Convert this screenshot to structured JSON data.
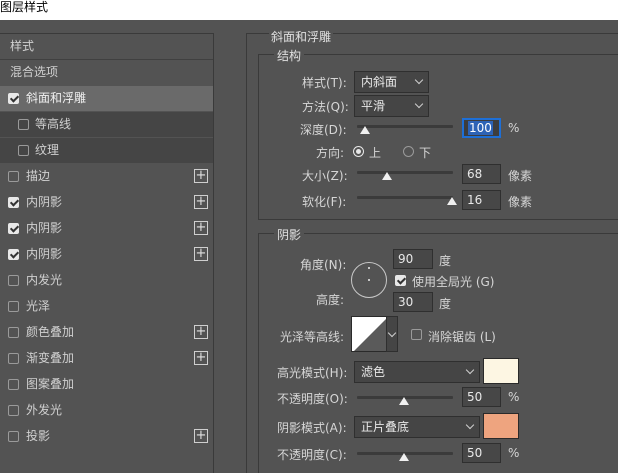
{
  "window": {
    "title": "图层样式"
  },
  "sidebar": {
    "header": "样式",
    "blend_options": "混合选项",
    "items": [
      {
        "label": "斜面和浮雕",
        "checked": true
      },
      {
        "label": "等高线",
        "checked": false
      },
      {
        "label": "纹理",
        "checked": false
      },
      {
        "label": "描边",
        "checked": false
      },
      {
        "label": "内阴影",
        "checked": true
      },
      {
        "label": "内阴影",
        "checked": true
      },
      {
        "label": "内阴影",
        "checked": true
      },
      {
        "label": "内发光",
        "checked": false
      },
      {
        "label": "光泽",
        "checked": false
      },
      {
        "label": "颜色叠加",
        "checked": false
      },
      {
        "label": "渐变叠加",
        "checked": false
      },
      {
        "label": "图案叠加",
        "checked": false
      },
      {
        "label": "外发光",
        "checked": false
      },
      {
        "label": "投影",
        "checked": false
      }
    ],
    "add_icon": "plus-icon"
  },
  "panel": {
    "title": "斜面和浮雕",
    "structure": {
      "legend": "结构",
      "style_label": "样式(T):",
      "style_value": "内斜面",
      "technique_label": "方法(Q):",
      "technique_value": "平滑",
      "depth_label": "深度(D):",
      "depth_value": "100",
      "depth_unit": "%",
      "depth_slider": 0.08,
      "direction_label": "方向:",
      "direction_up": "上",
      "direction_down": "下",
      "size_label": "大小(Z):",
      "size_value": "68",
      "size_unit": "像素",
      "size_slider": 0.3,
      "soften_label": "软化(F):",
      "soften_value": "16",
      "soften_unit": "像素",
      "soften_slider": 0.98
    },
    "shading": {
      "legend": "阴影",
      "angle_label": "角度(N):",
      "angle_value": "90",
      "angle_unit": "度",
      "global_light_label": "使用全局光 (G)",
      "altitude_label": "高度:",
      "altitude_value": "30",
      "altitude_unit": "度",
      "gloss_contour_label": "光泽等高线:",
      "anti_alias_label": "消除锯齿 (L)",
      "highlight_mode_label": "高光模式(H):",
      "highlight_mode_value": "滤色",
      "highlight_color": "#fdf6e3",
      "highlight_opacity_label": "不透明度(O):",
      "highlight_opacity_value": "50",
      "highlight_opacity_unit": "%",
      "highlight_opacity_slider": 0.5,
      "shadow_mode_label": "阴影模式(A):",
      "shadow_mode_value": "正片叠底",
      "shadow_color": "#eea47f",
      "shadow_opacity_label": "不透明度(C):",
      "shadow_opacity_value": "50",
      "shadow_opacity_unit": "%",
      "shadow_opacity_slider": 0.5
    }
  },
  "colors": {
    "accent": "#1e6fd6",
    "panel_bg": "#535353",
    "selected_row": "#6a6a6a"
  }
}
